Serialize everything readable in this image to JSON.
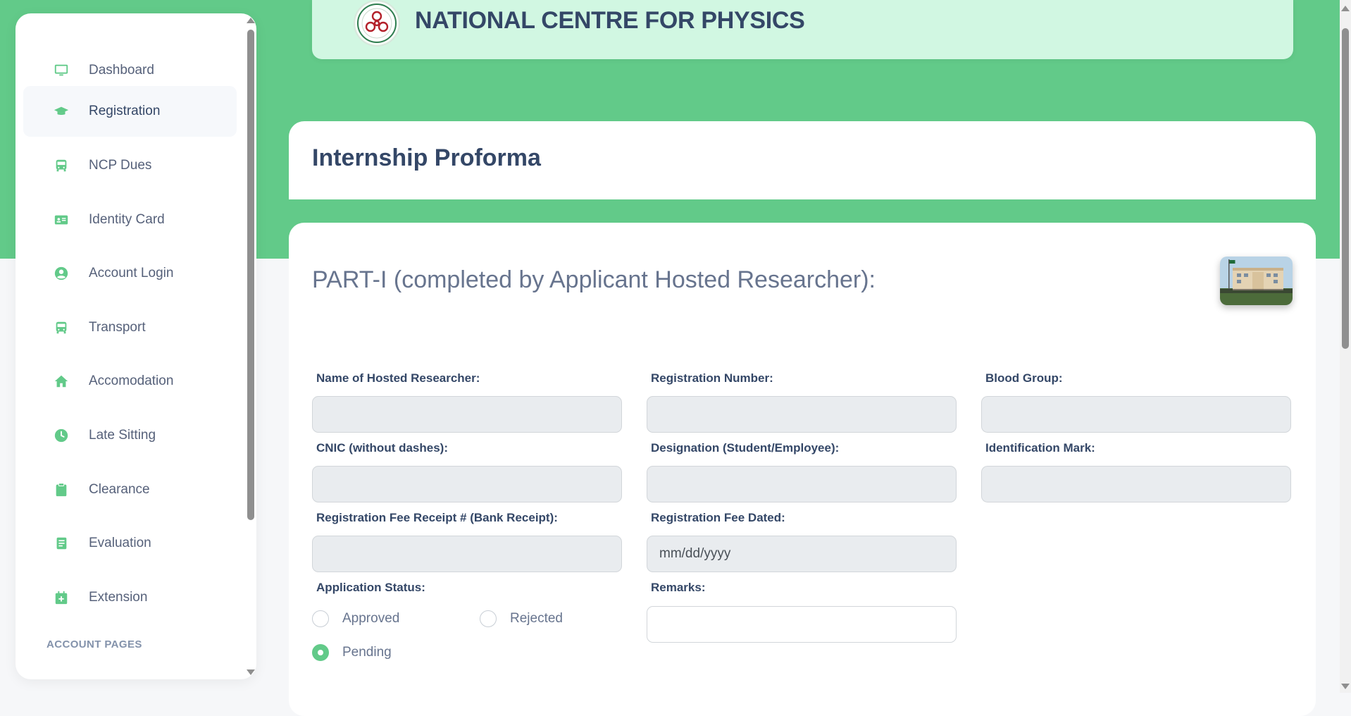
{
  "colors": {
    "accent": "#62ca89",
    "header_bg": "#d1f7e2",
    "text_dark": "#344767",
    "text_muted": "#67748e"
  },
  "sidebar": {
    "items": [
      {
        "label": "Dashboard",
        "icon": "monitor-icon",
        "active": false
      },
      {
        "label": "Registration",
        "icon": "graduation-cap-icon",
        "active": true
      },
      {
        "label": "NCP Dues",
        "icon": "bus-icon",
        "active": false
      },
      {
        "label": "Identity Card",
        "icon": "id-card-icon",
        "active": false
      },
      {
        "label": "Account Login",
        "icon": "user-circle-icon",
        "active": false
      },
      {
        "label": "Transport",
        "icon": "bus-icon",
        "active": false
      },
      {
        "label": "Accomodation",
        "icon": "home-icon",
        "active": false
      },
      {
        "label": "Late Sitting",
        "icon": "clock-icon",
        "active": false
      },
      {
        "label": "Clearance",
        "icon": "clipboard-icon",
        "active": false
      },
      {
        "label": "Evaluation",
        "icon": "book-icon",
        "active": false
      },
      {
        "label": "Extension",
        "icon": "calendar-plus-icon",
        "active": false
      }
    ],
    "section_label": "ACCOUNT PAGES"
  },
  "header": {
    "title": "NATIONAL CENTRE FOR PHYSICS"
  },
  "page": {
    "title": "Internship Proforma"
  },
  "form": {
    "part_title": "PART-I (completed by Applicant Hosted Researcher):",
    "fields": {
      "name": {
        "label": "Name of Hosted Researcher:",
        "value": ""
      },
      "reg_no": {
        "label": "Registration Number:",
        "value": ""
      },
      "blood_group": {
        "label": "Blood Group:",
        "value": ""
      },
      "cnic": {
        "label": "CNIC (without dashes):",
        "value": ""
      },
      "designation": {
        "label": "Designation (Student/Employee):",
        "value": ""
      },
      "identification_mark": {
        "label": "Identification Mark:",
        "value": ""
      },
      "fee_receipt": {
        "label": "Registration Fee Receipt # (Bank Receipt):",
        "value": ""
      },
      "fee_dated": {
        "label": "Registration Fee Dated:",
        "placeholder": "mm/dd/yyyy"
      },
      "remarks": {
        "label": "Remarks:",
        "value": ""
      }
    },
    "status": {
      "label": "Application Status:",
      "options": [
        "Approved",
        "Rejected",
        "Pending"
      ],
      "selected": "Pending"
    }
  }
}
